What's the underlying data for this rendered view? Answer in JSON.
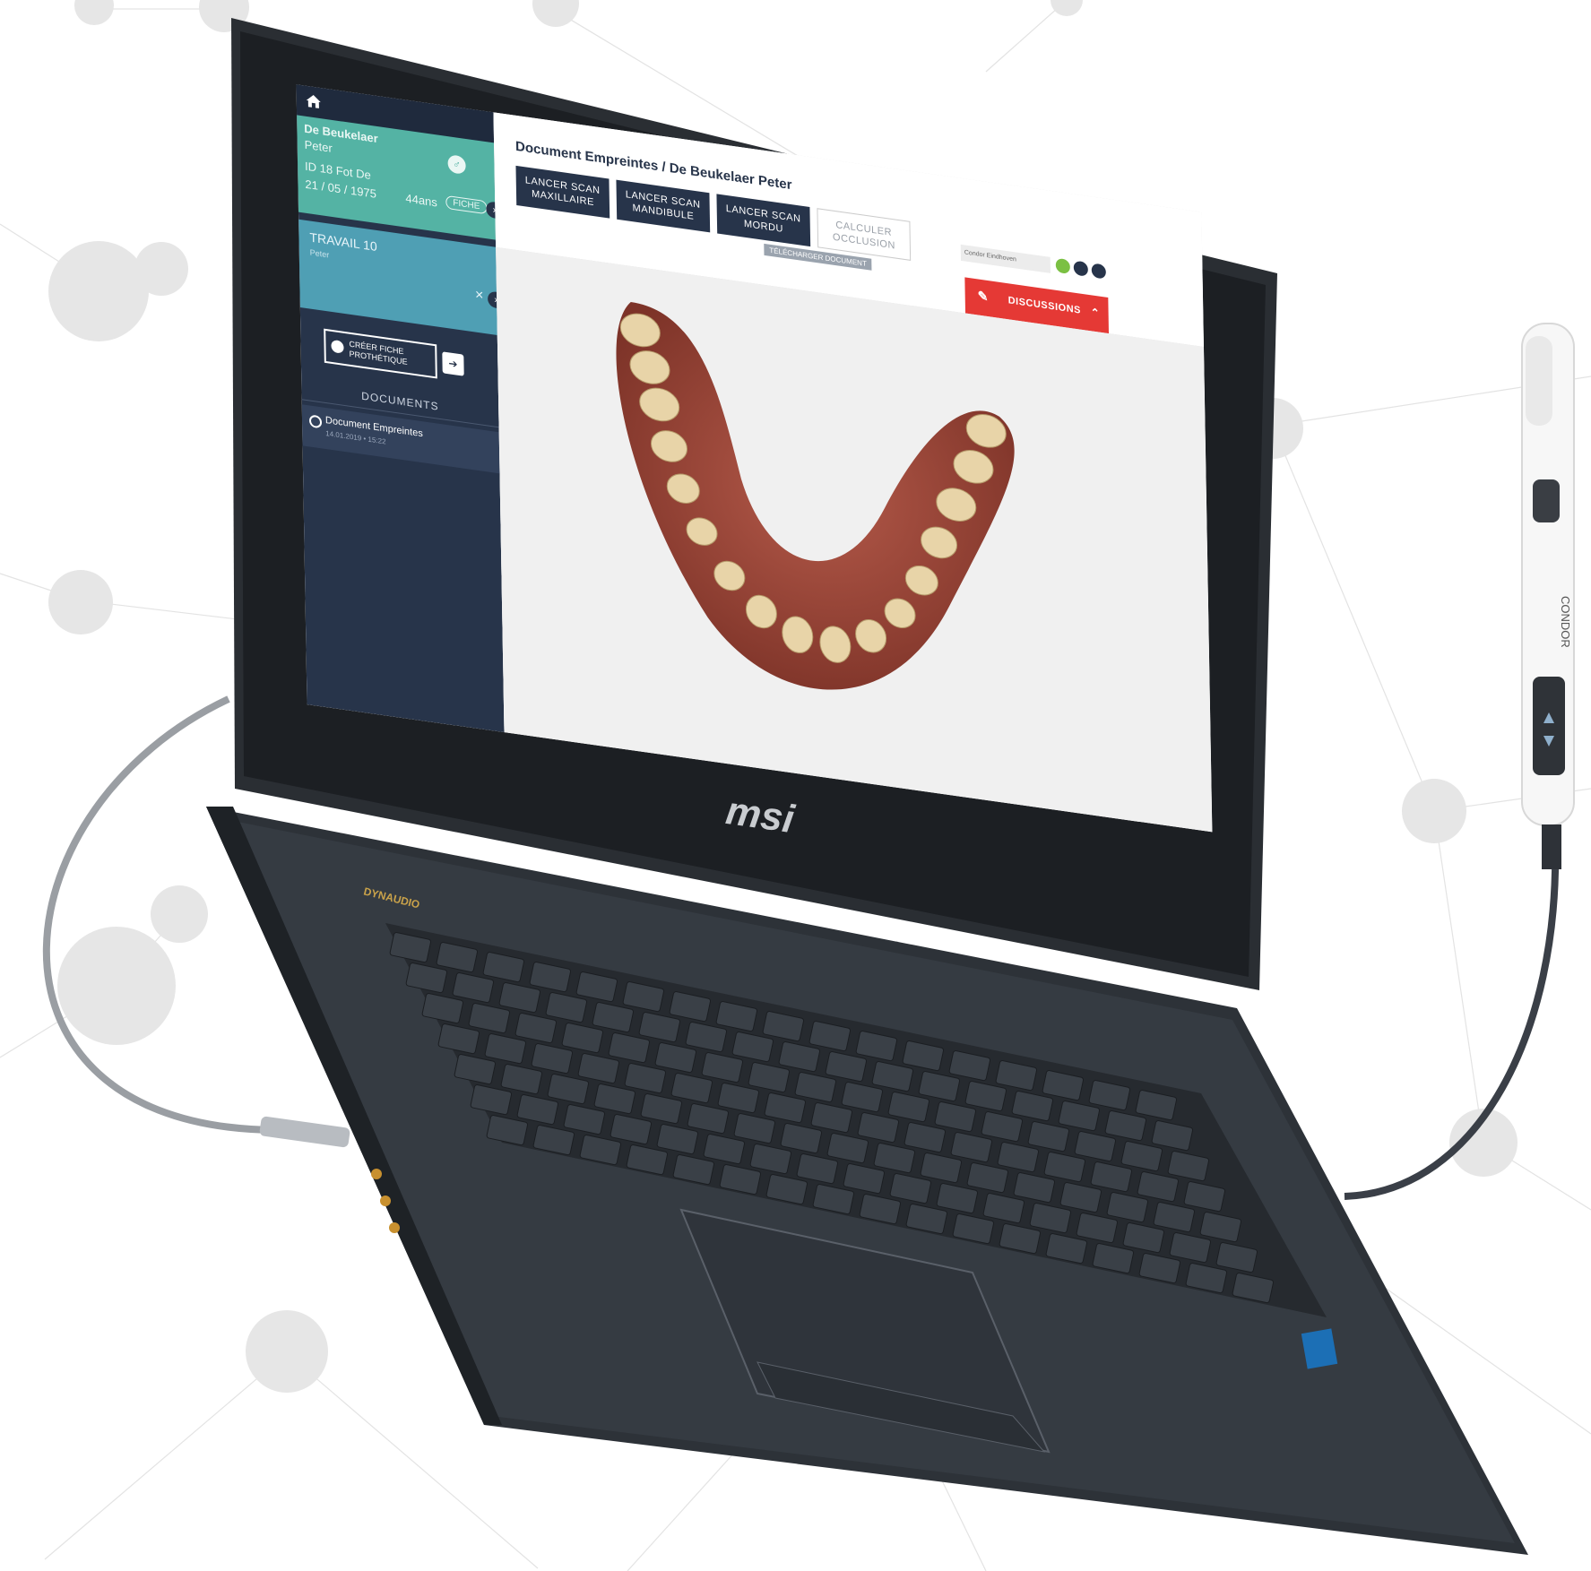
{
  "sidebar": {
    "home_icon": "home-icon",
    "patient": {
      "last_name": "De Beukelaer",
      "first_name": "Peter",
      "id": "ID 18 Fot De",
      "birth": "21 / 05 / 1975",
      "age": "44ans",
      "fiche_label": "FICHE"
    },
    "travail": {
      "title": "TRAVAIL 10",
      "subtitle": "Peter",
      "close": "×"
    },
    "create_button": "CRÉER FICHE PROTHÉTIQUE",
    "documents_title": "DOCUMENTS",
    "document": {
      "name": "Document Empreintes",
      "date": "14.01.2019 • 15:22"
    }
  },
  "main": {
    "breadcrumb": "Document Empreintes / De Beukelaer Peter",
    "tele_tag": "TÉLÉCHARGER DOCUMENT",
    "buttons": {
      "scan_maxillaire": "LANCER SCAN MAXILLAIRE",
      "scan_mandibule": "LANCER SCAN MANDIBULE",
      "scan_mordu": "LANCER SCAN MORDU",
      "calcul_occlusion": "CALCULER OCCLUSION"
    },
    "user": "Condor Eindhoven",
    "discussions": "DISCUSSIONS"
  },
  "hardware": {
    "brand": "msi",
    "audio_brand": "DYNAUDIO",
    "scanner_brand": "CONDOR"
  },
  "colors": {
    "sidebar": "#27344a",
    "patient_card": "#54b3a4",
    "travail_card": "#4f9fb4",
    "discussions": "#e53935"
  }
}
